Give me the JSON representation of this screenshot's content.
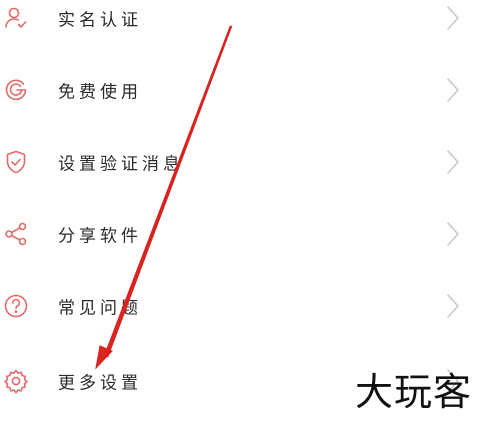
{
  "menu": {
    "items": [
      {
        "label": "实名认证",
        "icon": "person-check-icon"
      },
      {
        "label": "免费使用",
        "icon": "g-badge-icon"
      },
      {
        "label": "设置验证消息",
        "icon": "shield-check-icon"
      },
      {
        "label": "分享软件",
        "icon": "share-icon"
      },
      {
        "label": "常见问题",
        "icon": "question-circle-icon"
      },
      {
        "label": "更多设置",
        "icon": "gear-icon"
      }
    ]
  },
  "watermark": {
    "text": "大玩客"
  },
  "colors": {
    "icon": "#e36a6a",
    "text": "#2a2a2a",
    "chevron": "#c8c8c8",
    "arrow": "#d9231f",
    "background": "#ffffff"
  }
}
